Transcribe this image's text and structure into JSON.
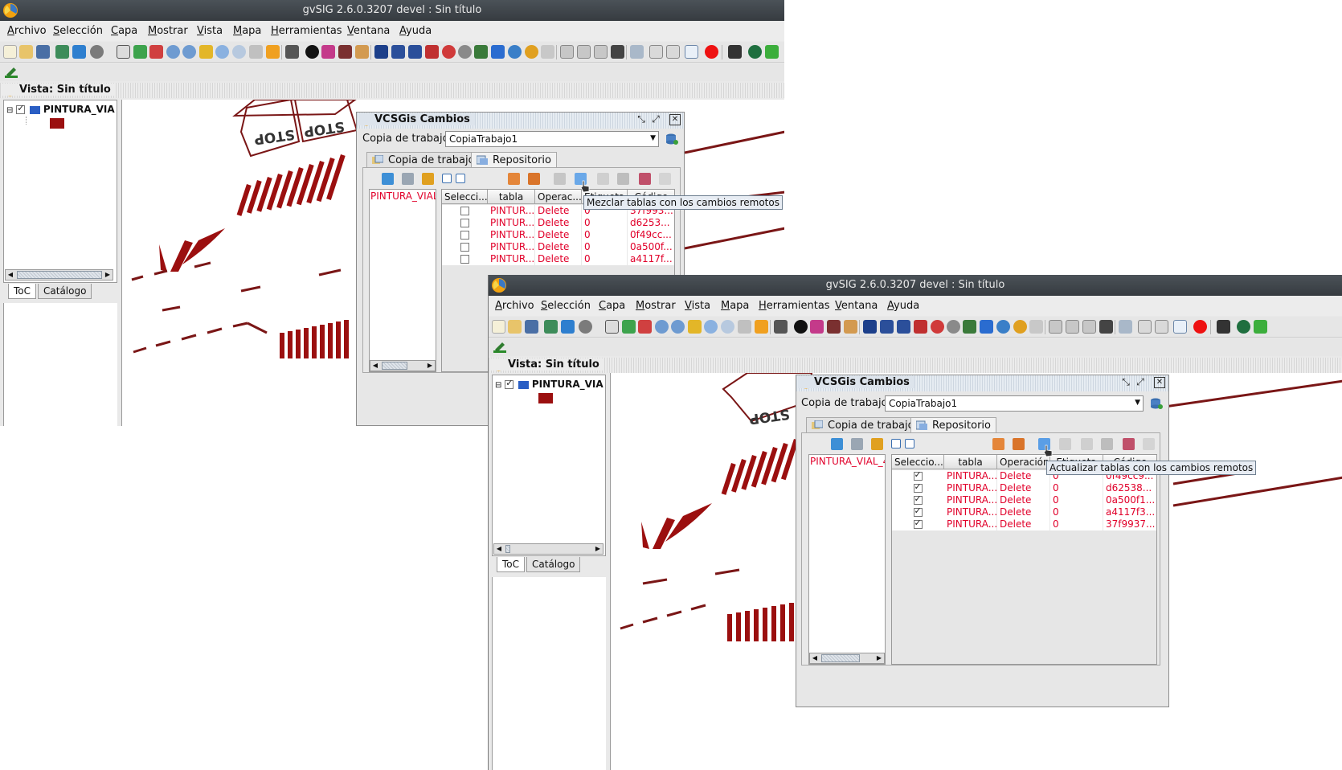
{
  "window_title": "gvSIG 2.6.0.3207 devel : Sin título",
  "menu": [
    "Archivo",
    "Selección",
    "Capa",
    "Mostrar",
    "Vista",
    "Mapa",
    "Herramientas",
    "Ventana",
    "Ayuda"
  ],
  "view": {
    "title": "Vista: Sin título",
    "layer_name": "PINTURA_VIA",
    "toc_tab": "ToC",
    "catalog_tab": "Catálogo"
  },
  "vcs": {
    "title": "VCSGis Cambios",
    "workspace_label": "Copia de trabajo",
    "workspace_value": "CopiaTrabajo1",
    "tab_working_copy": "Copia de trabajo",
    "tab_repository": "Repositorio",
    "columns": [
      "Selecci...",
      "tabla",
      "Operac...",
      "Etiqueta",
      "Código"
    ],
    "columns2": [
      "Seleccio...",
      "tabla",
      "Operación",
      "Etiqueta",
      "Código"
    ]
  },
  "window1": {
    "table_name": "PINTURA_VIAL",
    "tooltip": "Mezclar tablas con los cambios remotos",
    "rows": [
      {
        "checked": false,
        "tabla": "PINTUR...",
        "op": "Delete",
        "etiqueta": "0",
        "codigo": "37f993..."
      },
      {
        "checked": false,
        "tabla": "PINTUR...",
        "op": "Delete",
        "etiqueta": "0",
        "codigo": "d6253..."
      },
      {
        "checked": false,
        "tabla": "PINTUR...",
        "op": "Delete",
        "etiqueta": "0",
        "codigo": "0f49cc..."
      },
      {
        "checked": false,
        "tabla": "PINTUR...",
        "op": "Delete",
        "etiqueta": "0",
        "codigo": "0a500f..."
      },
      {
        "checked": false,
        "tabla": "PINTUR...",
        "op": "Delete",
        "etiqueta": "0",
        "codigo": "a4117f..."
      }
    ]
  },
  "window2": {
    "table_name": "PINTURA_VIAL_4(",
    "tooltip": "Actualizar tablas con los cambios remotos",
    "rows": [
      {
        "checked": true,
        "tabla": "PINTURA...",
        "op": "Delete",
        "etiqueta": "0",
        "codigo": "0f49cc9..."
      },
      {
        "checked": true,
        "tabla": "PINTURA...",
        "op": "Delete",
        "etiqueta": "0",
        "codigo": "d62538..."
      },
      {
        "checked": true,
        "tabla": "PINTURA...",
        "op": "Delete",
        "etiqueta": "0",
        "codigo": "0a500f1..."
      },
      {
        "checked": true,
        "tabla": "PINTURA...",
        "op": "Delete",
        "etiqueta": "0",
        "codigo": "a4117f3..."
      },
      {
        "checked": true,
        "tabla": "PINTURA...",
        "op": "Delete",
        "etiqueta": "0",
        "codigo": "37f9937..."
      }
    ]
  },
  "map_labels": [
    "STOP",
    "STOP"
  ],
  "colors": {
    "layer_fill": "#9b0f0f",
    "road_line": "#7a1616",
    "changes_text": "#e1002a"
  }
}
